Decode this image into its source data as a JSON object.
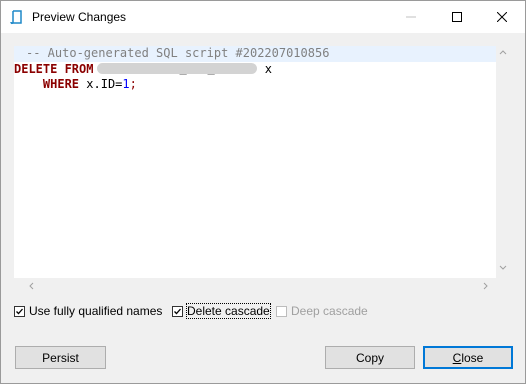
{
  "window": {
    "title": "Preview Changes",
    "icon": "document-script-icon"
  },
  "editor": {
    "comment_line": "-- Auto-generated SQL script #202207010856",
    "line2_keyword": "DELETE FROM",
    "line2_redacted_mark_1": "_",
    "line2_redacted_mark_2": "_",
    "line2_alias": "x",
    "line3_keyword": "WHERE",
    "line3_expr": "x.ID=",
    "line3_value": "1",
    "line3_end": ";"
  },
  "options": {
    "use_fully_qualified_names": {
      "label": "Use fully qualified names",
      "checked": true,
      "enabled": true
    },
    "delete_cascade": {
      "label": "Delete cascade",
      "checked": true,
      "enabled": true
    },
    "deep_cascade": {
      "label": "Deep cascade",
      "checked": false,
      "enabled": false
    }
  },
  "buttons": {
    "persist": "Persist",
    "copy": "Copy",
    "close_first": "C",
    "close_rest": "lose"
  },
  "colors": {
    "keyword": "#8b0000",
    "comment": "#808080",
    "number": "#0000ff",
    "highlight_line": "#e8f2fe",
    "default_button_border": "#0078d7"
  }
}
